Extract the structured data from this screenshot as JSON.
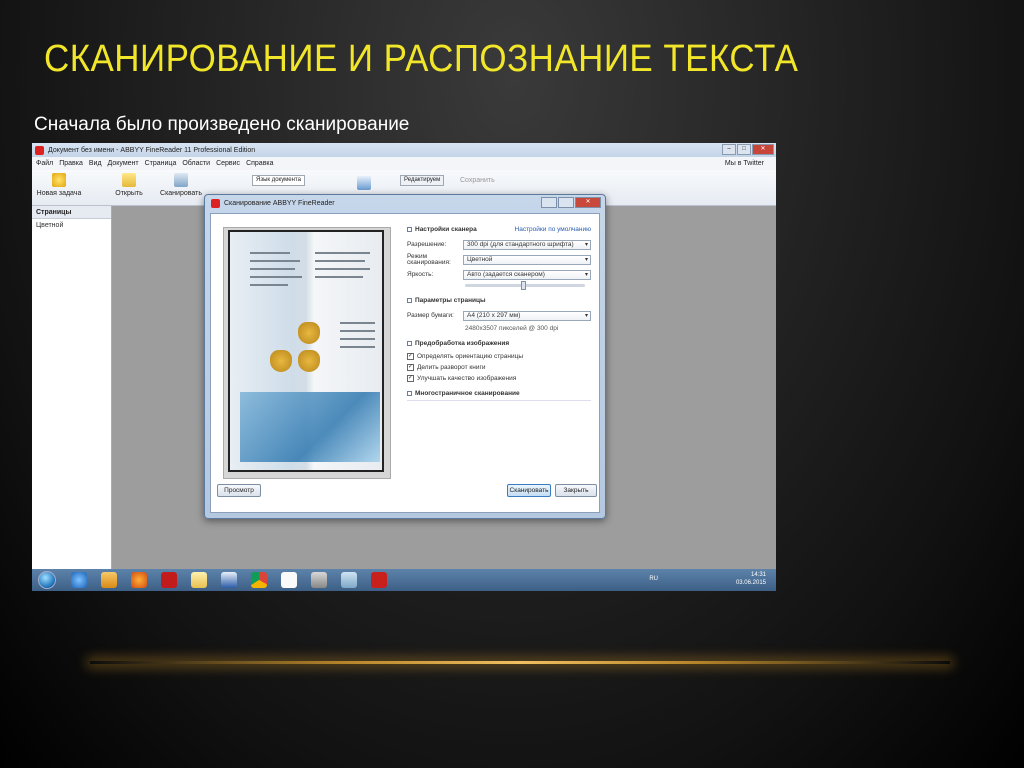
{
  "slide": {
    "title": "СКАНИРОВАНИЕ И РАСПОЗНАНИЕ ТЕКСТА",
    "subtitle": "Сначала было произведено сканирование"
  },
  "app": {
    "window_title": "Документ без имени - ABBYY FineReader 11 Professional Edition",
    "menu": [
      "Файл",
      "Правка",
      "Вид",
      "Документ",
      "Страница",
      "Области",
      "Сервис",
      "Справка"
    ],
    "twitter": "Мы в Twitter",
    "toolbar": {
      "new_task": "Новая задача",
      "open": "Открыть",
      "scan": "Сканировать",
      "doc_language": "Язык документа",
      "mode": "Редактируем",
      "save": "Сохранить"
    },
    "pages_panel": {
      "title": "Страницы",
      "color_mode": "Цветной"
    }
  },
  "dialog": {
    "title": "Сканирование ABBYY FineReader",
    "scanner_settings": {
      "title": "Настройки сканера",
      "default_link": "Настройки по умолчанию",
      "resolution_label": "Разрешение:",
      "resolution_value": "300 dpi (для стандартного шрифта)",
      "mode_label": "Режим сканирования:",
      "mode_value": "Цветной",
      "brightness_label": "Яркость:",
      "brightness_value": "Авто (задается сканером)"
    },
    "page_params": {
      "title": "Параметры страницы",
      "paper_label": "Размер бумаги:",
      "paper_value": "A4 (210 x 297 мм)",
      "pixels_hint": "2480x3507 пикселей @ 300 dpi"
    },
    "preprocessing": {
      "title": "Предобработка изображения",
      "options": [
        "Определять ориентацию страницы",
        "Делить разворот книги",
        "Улучшать качество изображения"
      ]
    },
    "multipage": {
      "title": "Многостраничное сканирование"
    },
    "buttons": {
      "preview": "Просмотр",
      "scan": "Сканировать",
      "close": "Закрыть"
    }
  },
  "taskbar": {
    "lang": "RU",
    "time": "14:31",
    "date": "03.06.2015"
  },
  "colors": {
    "title_yellow": "#f2e62a",
    "accent_line": "#f0c060"
  }
}
